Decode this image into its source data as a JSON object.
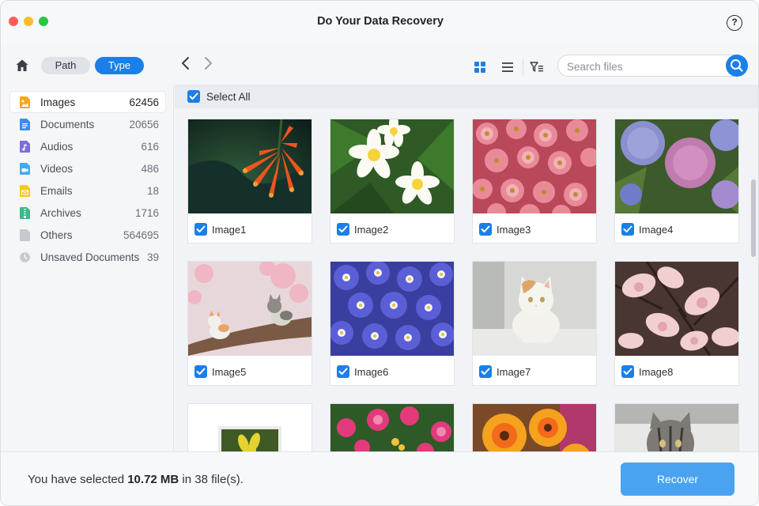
{
  "window": {
    "title": "Do Your Data Recovery",
    "help": "?"
  },
  "toolbar": {
    "tabs": [
      {
        "label": "Path",
        "active": false
      },
      {
        "label": "Type",
        "active": true
      }
    ],
    "search_placeholder": "Search files",
    "view_mode": "grid"
  },
  "sidebar": {
    "items": [
      {
        "label": "Images",
        "count": "62456",
        "icon": "image-file-icon",
        "color": "#f5a623",
        "active": true
      },
      {
        "label": "Documents",
        "count": "20656",
        "icon": "document-file-icon",
        "color": "#3b8ee8",
        "active": false
      },
      {
        "label": "Audios",
        "count": "616",
        "icon": "audio-file-icon",
        "color": "#7b6fe0",
        "active": false
      },
      {
        "label": "Videos",
        "count": "486",
        "icon": "video-file-icon",
        "color": "#45a9f0",
        "active": false
      },
      {
        "label": "Emails",
        "count": "18",
        "icon": "email-file-icon",
        "color": "#f5c824",
        "active": false
      },
      {
        "label": "Archives",
        "count": "1716",
        "icon": "archive-file-icon",
        "color": "#3fb88a",
        "active": false
      },
      {
        "label": "Others",
        "count": "564695",
        "icon": "other-file-icon",
        "color": "#c5cad1",
        "active": false
      },
      {
        "label": "Unsaved Documents",
        "count": "39",
        "icon": "clock-icon",
        "color": "#c5cad1",
        "active": false
      }
    ]
  },
  "content": {
    "select_all_label": "Select All",
    "select_all_checked": true,
    "images": [
      {
        "label": "Image1",
        "checked": true,
        "subject": "orange trumpet flowers"
      },
      {
        "label": "Image2",
        "checked": true,
        "subject": "white and yellow frangipani"
      },
      {
        "label": "Image3",
        "checked": true,
        "subject": "pink daisies"
      },
      {
        "label": "Image4",
        "checked": true,
        "subject": "purple hydrangeas"
      },
      {
        "label": "Image5",
        "checked": true,
        "subject": "kittens on branch with blossoms"
      },
      {
        "label": "Image6",
        "checked": true,
        "subject": "blue daisies"
      },
      {
        "label": "Image7",
        "checked": true,
        "subject": "white cat"
      },
      {
        "label": "Image8",
        "checked": true,
        "subject": "pink magnolia"
      },
      {
        "label": "",
        "checked": false,
        "subject": "framed yellow flower"
      },
      {
        "label": "",
        "checked": false,
        "subject": "pink flowers"
      },
      {
        "label": "",
        "checked": false,
        "subject": "orange gerbera"
      },
      {
        "label": "",
        "checked": false,
        "subject": "tabby cat"
      }
    ]
  },
  "footer": {
    "selected_prefix": "You have selected ",
    "selected_size": "10.72 MB",
    "selected_middle": " in ",
    "selected_count": "38",
    "selected_suffix": " file(s).",
    "recover_label": "Recover"
  },
  "colors": {
    "accent": "#1a7fe8",
    "recover_button": "#4aa3f0"
  }
}
